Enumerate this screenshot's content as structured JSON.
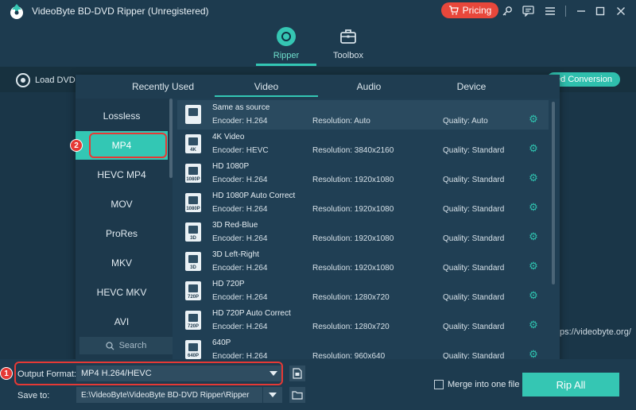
{
  "window": {
    "title": "VideoByte BD-DVD Ripper (Unregistered)",
    "pricing_label": "Pricing"
  },
  "nav": {
    "ripper_label": "Ripper",
    "toolbox_label": "Toolbox"
  },
  "toolbar": {
    "load_dvd_label": "Load DVD",
    "speed_label": "eed Conversion"
  },
  "background": {
    "url_text": "ps://videobyte.org/"
  },
  "format_panel": {
    "tabs": [
      "Recently Used",
      "Video",
      "Audio",
      "Device"
    ],
    "active_tab": "Video",
    "categories": [
      "Lossless",
      "MP4",
      "HEVC MP4",
      "MOV",
      "ProRes",
      "MKV",
      "HEVC MKV",
      "AVI"
    ],
    "active_category": "MP4",
    "search_placeholder": "Search",
    "presets": [
      {
        "name": "Same as source",
        "encoder": "Encoder: H.264",
        "resolution": "Resolution: Auto",
        "quality": "Quality: Auto",
        "badge": ""
      },
      {
        "name": "4K Video",
        "encoder": "Encoder: HEVC",
        "resolution": "Resolution: 3840x2160",
        "quality": "Quality: Standard",
        "badge": "4K"
      },
      {
        "name": "HD 1080P",
        "encoder": "Encoder: H.264",
        "resolution": "Resolution: 1920x1080",
        "quality": "Quality: Standard",
        "badge": "1080P"
      },
      {
        "name": "HD 1080P Auto Correct",
        "encoder": "Encoder: H.264",
        "resolution": "Resolution: 1920x1080",
        "quality": "Quality: Standard",
        "badge": "1080P"
      },
      {
        "name": "3D Red-Blue",
        "encoder": "Encoder: H.264",
        "resolution": "Resolution: 1920x1080",
        "quality": "Quality: Standard",
        "badge": "3D"
      },
      {
        "name": "3D Left-Right",
        "encoder": "Encoder: H.264",
        "resolution": "Resolution: 1920x1080",
        "quality": "Quality: Standard",
        "badge": "3D"
      },
      {
        "name": "HD 720P",
        "encoder": "Encoder: H.264",
        "resolution": "Resolution: 1280x720",
        "quality": "Quality: Standard",
        "badge": "720P"
      },
      {
        "name": "HD 720P Auto Correct",
        "encoder": "Encoder: H.264",
        "resolution": "Resolution: 1280x720",
        "quality": "Quality: Standard",
        "badge": "720P"
      },
      {
        "name": "640P",
        "encoder": "Encoder: H.264",
        "resolution": "Resolution: 960x640",
        "quality": "Quality: Standard",
        "badge": "640P"
      }
    ]
  },
  "bottom": {
    "output_format_label": "Output Format:",
    "output_format_value": "MP4 H.264/HEVC",
    "save_to_label": "Save to:",
    "save_path": "E:\\VideoByte\\VideoByte BD-DVD Ripper\\Ripper",
    "merge_label": "Merge into one file",
    "rip_all_label": "Rip All"
  },
  "annotations": {
    "step1": "1",
    "step2": "2"
  },
  "colors": {
    "accent": "#33c7b4",
    "pricing": "#e8473b",
    "callout": "#e53935"
  }
}
